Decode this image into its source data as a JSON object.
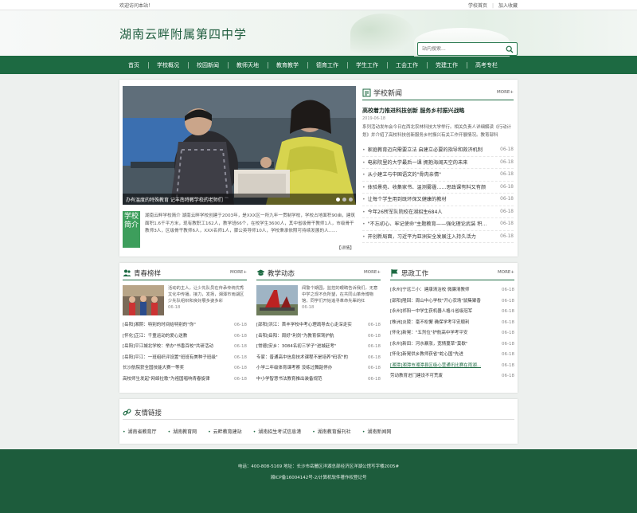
{
  "topbar": {
    "welcome": "欢迎访问本站！",
    "home": "学校首页",
    "favorite": "加入收藏"
  },
  "header": {
    "school_name": "湖南云畔附属第四中学",
    "search_placeholder": "站内搜索..."
  },
  "nav": [
    "首页",
    "学校概况",
    "校园新闻",
    "教师天地",
    "教育教学",
    "德育工作",
    "学生工作",
    "工会工作",
    "党建工作",
    "高考专栏"
  ],
  "slider": {
    "caption": "办有温度的特殊教育 记丰南特教学校的老师们"
  },
  "intro": {
    "badge": "学校简介",
    "text": "湖南云畔学校简介 湖南云畔学校创建于2003年，是XXX区一所九年一贯制学校，学校占地面积90亩，建筑面积1.6千平方米，现有教职工162人，教学班66个，在校学生3600人，其中省级骨干教师1人，市级骨干教师3人，区级骨干教师6人，XXX名师1人，骤公英导师10人，学校秉承依照可持续发展的人......",
    "more": "【详情】"
  },
  "news": {
    "title": "学校新闻",
    "more": "MORE+",
    "headline": "高校着力推进科技创新 服务乡村振兴战略",
    "date": "2019-06-18",
    "summary": "系列活动发布会今日在西北农林科技大学举行。相关负责人详细解读《行动计划》并介绍了高校科技创新服务乡村振兴有关工作开展情况。教育部科",
    "items": [
      {
        "title": "家庭教育迈向需要立法 启建立必要的指导和救济机制",
        "date": "06-18"
      },
      {
        "title": "电影院里的大学最后一课 拥抱海阔天空的未来",
        "date": "06-18"
      },
      {
        "title": "从小建立与中国语文的\"骨肉亲情\"",
        "date": "06-18"
      },
      {
        "title": "体验景苑、收集家书、温测雾霾……思政课有料又有颜",
        "date": "06-18"
      },
      {
        "title": "让每个学生用到既环保又健康的教材",
        "date": "06-18"
      },
      {
        "title": "今年26所军队院校在湖招生684人",
        "date": "06-18"
      },
      {
        "title": "\"不忘初心、牢记使命\"主题教育——强化理论武装 积...",
        "date": "06-18"
      },
      {
        "title": "开创新局面，习近平为亚洲安全发展注入持久活力",
        "date": "06-18"
      }
    ]
  },
  "youth": {
    "title": "青春榜样",
    "more": "MORE+",
    "feature_text": "活动的主人，让少先队员在传承传统优秀文化中传播，接力，发扬，湘潭市雨湖区少先队组织和良好展多姿多彩",
    "feature_date": "06-18",
    "items": [
      {
        "title": "[岳阳]湘阴：特别的时间给特别的\"你\"",
        "date": "06-18"
      },
      {
        "title": "[怀化]芷江：千童运动的爱心送教",
        "date": "06-18"
      },
      {
        "title": "[岳阳]平江城北学校：举办\"书香百校\"共研活动",
        "date": "06-18"
      },
      {
        "title": "[岳阳]平江：一班组织评设置\"班班有美种子班级\"",
        "date": "06-18"
      },
      {
        "title": "长沙航院获全国技能大赛一等奖",
        "date": "06-18"
      },
      {
        "title": "高校师生发起\"网络拉歌\"为祖国唱响青春旋律",
        "date": "06-18"
      }
    ]
  },
  "teaching": {
    "title": "教学动态",
    "more": "MORE+",
    "feature_text": "闻警个期园，监控的眼睛告诉我们，无意中学之现不负所望，在共同山革命博物馆，同学们开始追寻革命先辈的红",
    "feature_date": "06-18",
    "items": [
      {
        "title": "[邵阳]洪江：首丰学校中考心理疏导去心走深走实",
        "date": "06-18"
      },
      {
        "title": "[岳阳]岳阳：周好\"利剑\"为教育保驾护航",
        "date": "06-18"
      },
      {
        "title": "[常德]安乡：3084名初三学子\"进城赶考\"",
        "date": "06-18"
      },
      {
        "title": "专家：普通高中信息技术课程不是培养\"码农\"的",
        "date": "06-18"
      },
      {
        "title": "小学二年级体育课考察 没练过舞蹈停办",
        "date": "06-18"
      },
      {
        "title": "中小学智慧书法教育推出装备规范",
        "date": "06-18"
      }
    ]
  },
  "ideology": {
    "title": "思政工作",
    "more": "MORE+",
    "items": [
      {
        "title": "[永州]宁远三小：建康清洁校 微廉清教师",
        "date": "06-18"
      },
      {
        "title": "[邵阳]隆回：周山中心学校\"开心农场\"鼠集聚香",
        "date": "06-18"
      },
      {
        "title": "[永州]祁阳一中学生获机器人格斗省级冠军",
        "date": "06-18"
      },
      {
        "title": "[株洲]炎陵：毫不松懈 确保学考平安顺利",
        "date": "06-18"
      },
      {
        "title": "[怀化]新晃：\"五剂位\"护航高中学考平安",
        "date": "06-18"
      },
      {
        "title": "[永州]新田：河水暴涨，宽情蔓草\"莫歇\"",
        "date": "06-18"
      },
      {
        "title": "[怀化]新晃供乡教师获省\"蛇心国\"先进",
        "date": "06-18"
      },
      {
        "title": "[湘潭]湘潭市湘潭县区级心营通讯比赛在雨湖...",
        "date": "06-18"
      },
      {
        "title": "劳动教育进门建设不可荒废",
        "date": "06-18"
      }
    ]
  },
  "friends": {
    "title": "友情链接",
    "links": [
      "湖南省教育厅",
      "湖南教育网",
      "云畔教育建站",
      "湖南招生考试信息港",
      "湖南教育报刊社",
      "湖南新闻网"
    ]
  },
  "footer": {
    "line1": "电话：400-808-5169 地址：长沙市岳麓区洋湖总部经济区洋湖公馆写字楼2005#",
    "line2": "湘ICP备16004142号-2/计算机软件著作权登记号"
  },
  "colors": {
    "primary": "#1d6a42",
    "badge": "#3d9e5c",
    "footer": "#1d5c3c"
  }
}
